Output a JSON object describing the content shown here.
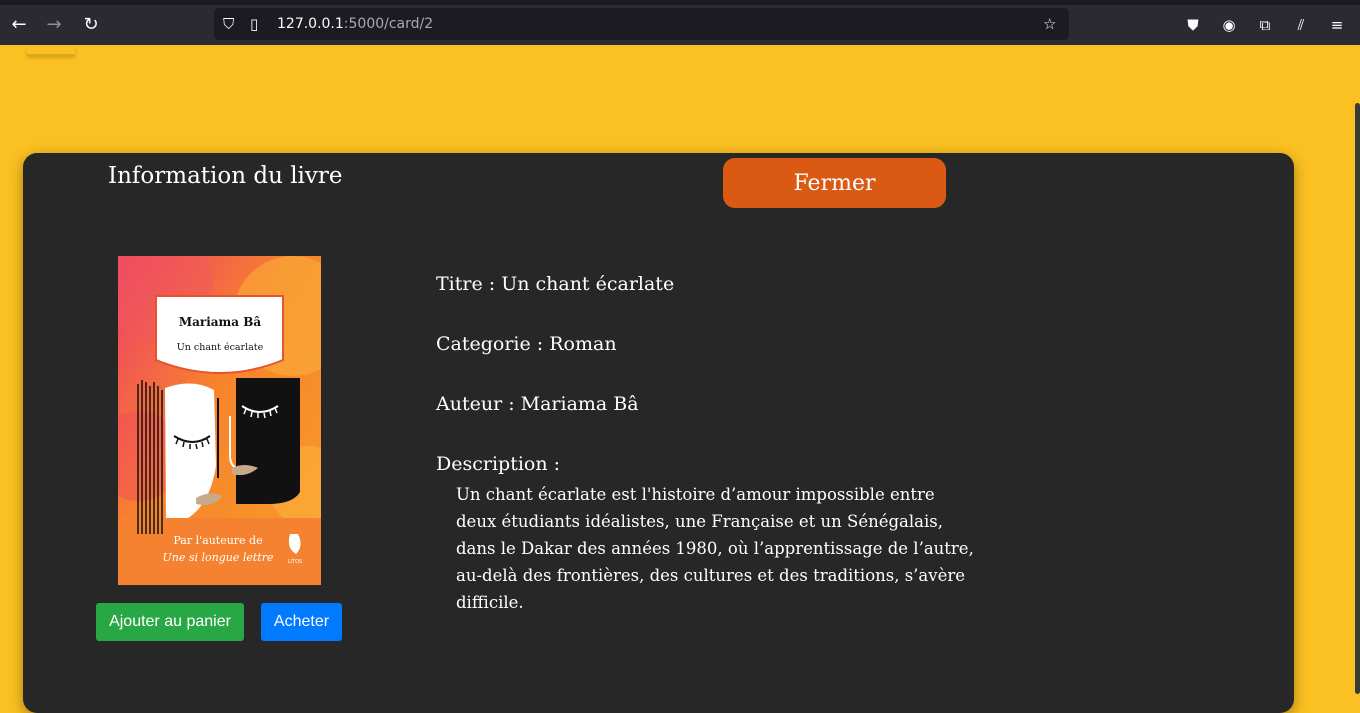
{
  "browser": {
    "url_host": "127.0.0.1",
    "url_path": ":5000/card/2"
  },
  "modal": {
    "title": "Information du livre",
    "close_label": "Fermer"
  },
  "book": {
    "cover": {
      "author": "Mariama Bâ",
      "title": "Un chant écarlate",
      "tagline_1": "Par l'auteure de",
      "tagline_2": "Une si longue lettre",
      "publisher": "LITOS"
    },
    "title_label": "Titre : ",
    "title": "Un chant écarlate",
    "category_label": "Categorie : ",
    "category": "Roman",
    "author_label": "Auteur : ",
    "author": "Mariama Bâ",
    "description_label": "Description :",
    "description": "Un chant écarlate est l'histoire d’amour impossible entre deux étudiants idéalistes, une Française et un Sénégalais, dans le Dakar des années 1980, où l’apprentissage de l’autre, au-delà des frontières, des cultures et des traditions, s’avère difficile."
  },
  "actions": {
    "add_to_cart": "Ajouter au panier",
    "buy": "Acheter"
  },
  "colors": {
    "page_bg": "#fbc021",
    "card_bg": "#272727",
    "close_button": "#da5a13",
    "cart_button": "#28a745",
    "buy_button": "#007bff"
  }
}
